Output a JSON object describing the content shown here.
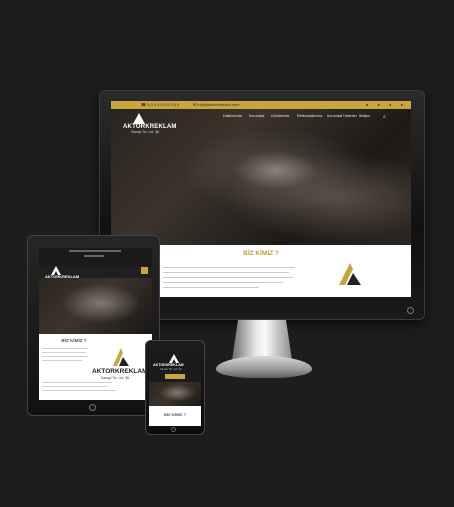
{
  "desktop": {
    "topbar": {
      "phone": "☎ 0 0 0 0 0 0 0 0 0 0",
      "email": "✉ info@aktorkreklam.com"
    },
    "logo": {
      "name": "AKTORKREKLAM",
      "sub": "Sanayi Tic. Ltd. Şti."
    },
    "nav": [
      "Hakkımızda",
      "Kurumsal",
      "Ürünlerimiz",
      "Referanslarımız",
      "Kurumsal Haberler",
      "İletişim"
    ],
    "section_title": "BİZ KİMİZ ?",
    "search_icon": "search-icon"
  },
  "tablet": {
    "logo": {
      "name": "AKTORKREKLAM",
      "sub": "Sanayi Tic. Ltd. Şti."
    },
    "section_title": "BİZ KİMİZ ?",
    "brand": {
      "name": "AKTORKREKLAM",
      "sub": "Sanayi Tic. Ltd. Şti."
    }
  },
  "phone": {
    "logo": {
      "name": "AKTORKREKLAM",
      "sub": "Sanayi Tic. Ltd. Şti."
    },
    "section_title": "BİZ KİMİZ ?"
  },
  "colors": {
    "accent": "#c9a43f",
    "background": "#1e1c1d"
  }
}
